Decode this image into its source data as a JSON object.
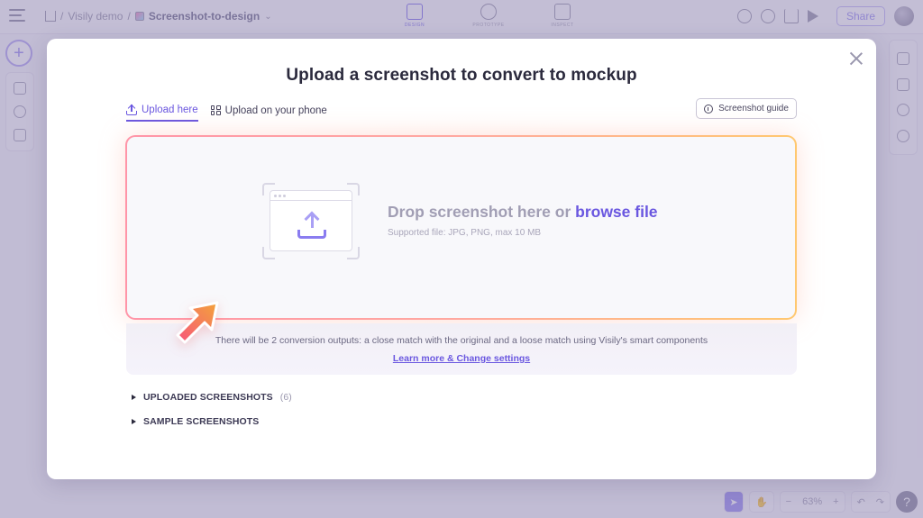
{
  "app": {
    "breadcrumb": {
      "items": [
        "Visily demo",
        "Screenshot-to-design"
      ],
      "separator": "/"
    },
    "modes": [
      {
        "label": "DESIGN",
        "icon": "design-icon",
        "active": true
      },
      {
        "label": "PROTOTYPE",
        "icon": "prototype-icon",
        "active": false
      },
      {
        "label": "INSPECT",
        "icon": "inspect-icon",
        "active": false
      }
    ],
    "top_right": {
      "share_label": "Share",
      "icons": [
        "search-icon",
        "comment-icon",
        "download-icon",
        "play-icon"
      ]
    },
    "left_rail": {
      "add_label": "+",
      "icons": [
        "components-icon",
        "emoji-icon",
        "pages-icon"
      ]
    },
    "right_rail": {
      "icons": [
        "properties-icon",
        "layers-icon",
        "find-icon",
        "palette-icon"
      ]
    },
    "bottom_bar": {
      "zoom_minus": "−",
      "zoom_level": "63%",
      "zoom_plus": "+",
      "undo": "↶",
      "redo": "↷",
      "help": "?"
    }
  },
  "modal": {
    "title": "Upload a screenshot to convert to mockup",
    "tabs": [
      {
        "label": "Upload here",
        "icon": "upload-icon",
        "active": true
      },
      {
        "label": "Upload on your phone",
        "icon": "qr-code-icon",
        "active": false
      }
    ],
    "guide_button": "Screenshot guide",
    "dropzone": {
      "main_text": "Drop screenshot here or ",
      "link_text": "browse file",
      "sub_text": "Supported file: JPG, PNG, max 10 MB"
    },
    "info": {
      "text": "There will be 2 conversion outputs: a close match with the original and a loose match using Visily's smart components",
      "link": "Learn more & Change settings"
    },
    "sections": [
      {
        "label": "UPLOADED SCREENSHOTS",
        "count": "(6)"
      },
      {
        "label": "SAMPLE SCREENSHOTS",
        "count": ""
      }
    ]
  },
  "colors": {
    "accent": "#6a57e0",
    "dropzone_border_start": "#ff95a8",
    "dropzone_border_end": "#ffc870",
    "arrow_start": "#f7567c",
    "arrow_end": "#f3a33a"
  }
}
